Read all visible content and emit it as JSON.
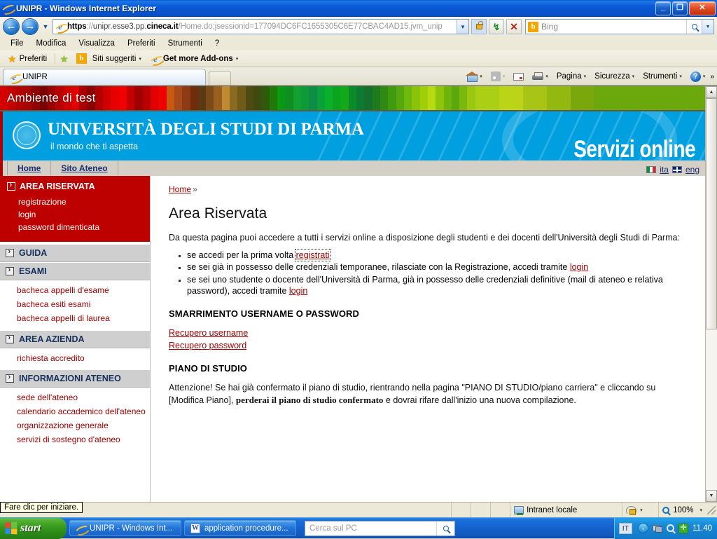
{
  "window": {
    "title": "UNIPR - Windows Internet Explorer",
    "minimize": "_",
    "maximize": "❐",
    "close": "✕"
  },
  "nav": {
    "back": "←",
    "forward": "→",
    "history_caret": "▼",
    "url_scheme": "https",
    "url_sep": "://",
    "url_host_pre": "unipr.esse3.pp.",
    "url_host_bold": "cineca.it",
    "url_path": "/Home.do;jsessionid=177094DC6FC1655305C6E77CBAC4AD15.jvm_unip",
    "dropdown_caret": "▼",
    "refresh": "↯",
    "stop": "✕",
    "search_engine": "Bing",
    "search_logo_letter": "b",
    "search_caret": "▼"
  },
  "menu": {
    "items": [
      "File",
      "Modifica",
      "Visualizza",
      "Preferiti",
      "Strumenti",
      "?"
    ]
  },
  "favbar": {
    "favorites_label": "Preferiti",
    "suggested_sites": "Siti suggeriti",
    "suggested_logo_letter": "b",
    "get_addons": "Get more Add-ons",
    "caret": "▾"
  },
  "tabs": {
    "active_tab": "UNIPR",
    "new_tab_tooltip": ""
  },
  "commandbar": {
    "home": "",
    "feeds": "",
    "mail": "",
    "print": "",
    "page": "Pagina",
    "safety": "Sicurezza",
    "tools": "Strumenti",
    "help": "?",
    "overflow": "»",
    "caret": "▾"
  },
  "testbanner": {
    "label": "Ambiente di test"
  },
  "uniheader": {
    "title": "UNIVERSITÀ DEGLI STUDI DI PARMA",
    "tagline": "il mondo che ti aspetta",
    "services": "Servizi online"
  },
  "navstrip": {
    "links": [
      "Home",
      "Sito Ateneo"
    ],
    "lang_it": "ita",
    "lang_en": "eng"
  },
  "sidebar": {
    "sections": [
      {
        "title": "AREA RISERVATA",
        "style": "red",
        "links": [
          "registrazione",
          "login",
          "password dimenticata"
        ]
      },
      {
        "title": "GUIDA",
        "style": "gray",
        "links": []
      },
      {
        "title": "ESAMI",
        "style": "gray",
        "links": [
          "bacheca appelli d'esame",
          "bacheca esiti esami",
          "bacheca appelli di laurea"
        ]
      },
      {
        "title": "AREA AZIENDA",
        "style": "gray",
        "links": [
          "richiesta accredito"
        ]
      },
      {
        "title": "INFORMAZIONI ATENEO",
        "style": "gray",
        "links": [
          "sede dell'ateneo",
          "calendario accademico dell'ateneo",
          "organizzazione generale",
          "servizi di sostegno d'ateneo"
        ]
      }
    ]
  },
  "content": {
    "breadcrumb_home": "Home",
    "breadcrumb_sep": "»",
    "page_title": "Area Riservata",
    "intro": "Da questa pagina puoi accedere a tutti i servizi online a disposizione degli studenti e dei docenti dell'Università degli Studi di Parma:",
    "bullets": [
      {
        "pre": "se accedi per la prima volta ",
        "link": "registrati",
        "post": "",
        "focused": true
      },
      {
        "pre": "se sei già in possesso delle credenziali temporanee, rilasciate con la Registrazione, accedi tramite ",
        "link": "login",
        "post": "",
        "focused": false
      },
      {
        "pre": "se sei uno studente o docente dell'Università di Parma, già in possesso delle credenziali definitive (mail di ateneo e relativa password), accedi tramite ",
        "link": "login",
        "post": "",
        "focused": false
      }
    ],
    "section_lost_title": "SMARRIMENTO USERNAME O PASSWORD",
    "recover_links": [
      "Recupero username",
      "Recupero password"
    ],
    "section_plan_title": "PIANO DI STUDIO",
    "warn_pre": "Attenzione! Se hai già confermato il piano di studio, rientrando nella pagina \"PIANO DI STUDIO/piano carriera\" e cliccando su [Modifica Piano], ",
    "warn_bold": "perderai il piano di studio confermato",
    "warn_post": " e dovrai rifare dall'inizio una nuova compilazione."
  },
  "statusbar": {
    "tooltip": "Fare clic per iniziare.",
    "zone": "Intranet locale",
    "zoom": "100%",
    "caret": "▾"
  },
  "taskbar": {
    "start": "start",
    "buttons": [
      {
        "label": "UNIPR - Windows Int...",
        "icon": "ie-icon"
      },
      {
        "label": "application procedure...",
        "icon": "word-icon"
      }
    ],
    "deskbar_placeholder": "Cerca sul PC",
    "language": "IT",
    "clock": "11.40"
  },
  "colors": {
    "titlebar_blue": "#0a5ad8",
    "banner_red": "#bd0000",
    "header_cyan": "#00a0e0",
    "link_red": "#a10000",
    "nav_navy": "#1b2f6e",
    "sidebar_gray": "#cfcfcf"
  },
  "banner_stripes": [
    "#d40000",
    "#c20000",
    "#b30000",
    "#a80404",
    "#8e0303",
    "#7a0202",
    "#9b0000",
    "#b80000",
    "#cf0000",
    "#e00000",
    "#a80000",
    "#8c0000",
    "#b00000",
    "#d10000",
    "#e60000",
    "#f00000",
    "#c40000",
    "#a00000",
    "#b90000",
    "#e00000",
    "#ef0000",
    "#c85a10",
    "#a8491a",
    "#8e3a12",
    "#6f2d0e",
    "#5a3a14",
    "#7a4a18",
    "#9a5e1e",
    "#c08a32",
    "#8a6a20",
    "#6f5a18",
    "#4f4a14",
    "#3f4a10",
    "#2f5a0c",
    "#1f7a08",
    "#0a9a12",
    "#0f8f22",
    "#12a030",
    "#0f9a3a",
    "#0e8e44",
    "#0aa03a",
    "#08b02c",
    "#0aa41e",
    "#12a818",
    "#0a8a28",
    "#0d7a34",
    "#16702c",
    "#1f7a1c",
    "#2f8a14",
    "#3f9a10",
    "#55a80e",
    "#6fb80c",
    "#8ac40a",
    "#a0cf08",
    "#b8da10",
    "#8fc40c",
    "#6fb40a",
    "#5aa80c",
    "#7ab80e",
    "#9ac810",
    "#aacf14",
    "#bcd418",
    "#a8c414",
    "#93b810",
    "#7aa80c"
  ]
}
